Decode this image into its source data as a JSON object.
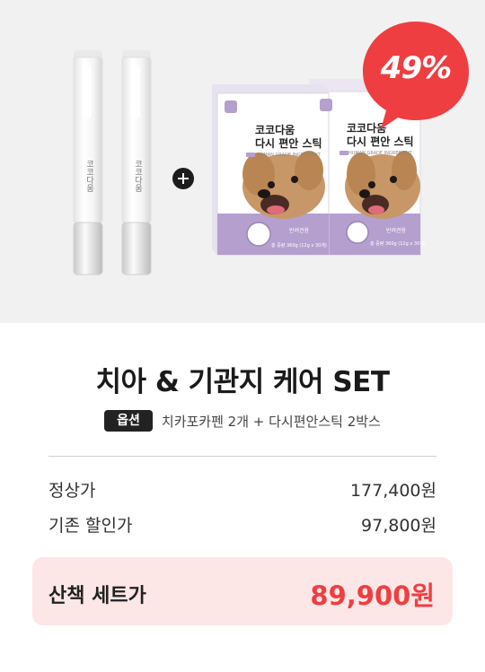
{
  "hero": {
    "pen_brand": "코코다움",
    "box_title_line1": "코코다움",
    "box_title_line2": "다시 편안 스틱",
    "box_subtitle": "HUMAN GRADE INGREDIENT",
    "box_footer": "총 중량 360g (12g x 30개)",
    "box_note": "반려견용",
    "discount_badge": "49%"
  },
  "product": {
    "title": "치아 & 기관지 케어 SET",
    "option_label": "옵션",
    "option_value": "치카포카펜 2개 + 다시편안스틱 2박스"
  },
  "prices": {
    "regular_label": "정상가",
    "regular_value": "177,400원",
    "existing_discount_label": "기존 할인가",
    "existing_discount_value": "97,800원",
    "set_label": "산책 세트가",
    "set_value": "89,900원"
  },
  "colors": {
    "accent_red": "#ee3e41",
    "set_box_bg": "#fde6e6",
    "box_purple": "#b59fcf"
  },
  "icons": [
    "plus-icon",
    "paw-icon",
    "dog-icon",
    "flower-logo-icon"
  ]
}
